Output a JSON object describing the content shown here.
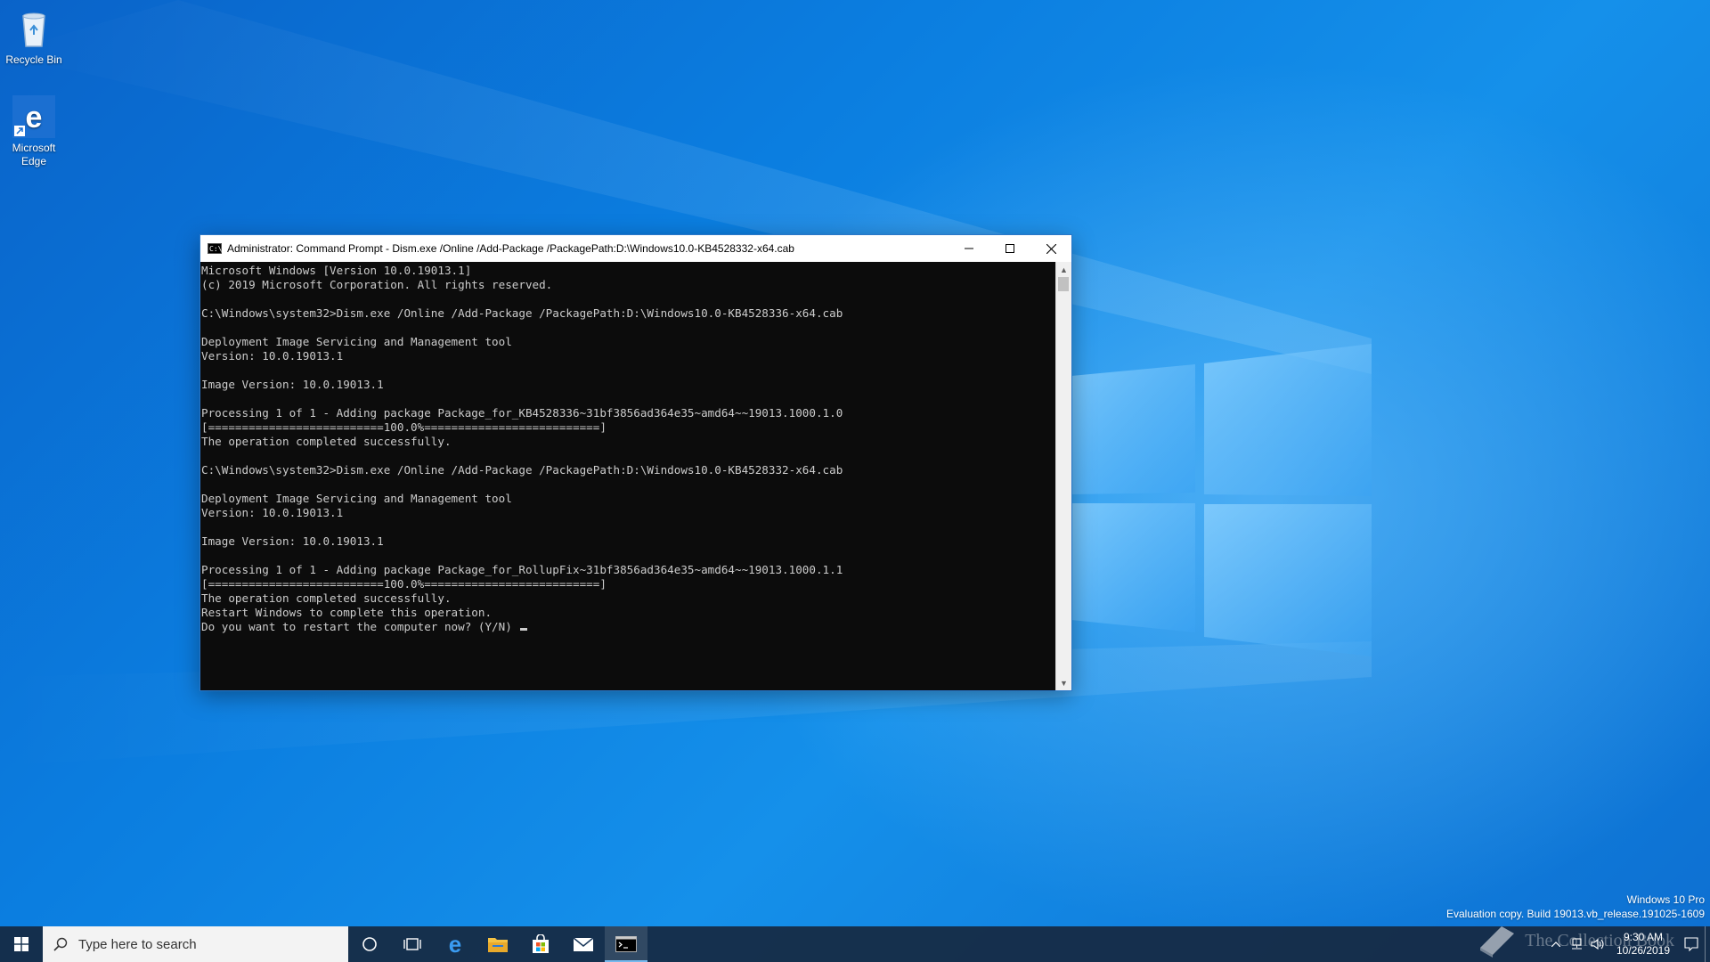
{
  "desktop": {
    "icons": [
      {
        "label": "Recycle Bin",
        "icon": "recycle-bin-icon"
      },
      {
        "label": "Microsoft Edge",
        "icon": "edge-icon"
      }
    ]
  },
  "window": {
    "title": "Administrator: Command Prompt - Dism.exe  /Online /Add-Package /PackagePath:D:\\Windows10.0-KB4528332-x64.cab",
    "controls": {
      "minimize": "minimize-icon",
      "maximize": "maximize-icon",
      "close": "close-icon"
    },
    "console_lines": [
      "Microsoft Windows [Version 10.0.19013.1]",
      "(c) 2019 Microsoft Corporation. All rights reserved.",
      "",
      "C:\\Windows\\system32>Dism.exe /Online /Add-Package /PackagePath:D:\\Windows10.0-KB4528336-x64.cab",
      "",
      "Deployment Image Servicing and Management tool",
      "Version: 10.0.19013.1",
      "",
      "Image Version: 10.0.19013.1",
      "",
      "Processing 1 of 1 - Adding package Package_for_KB4528336~31bf3856ad364e35~amd64~~19013.1000.1.0",
      "[==========================100.0%==========================]",
      "The operation completed successfully.",
      "",
      "C:\\Windows\\system32>Dism.exe /Online /Add-Package /PackagePath:D:\\Windows10.0-KB4528332-x64.cab",
      "",
      "Deployment Image Servicing and Management tool",
      "Version: 10.0.19013.1",
      "",
      "Image Version: 10.0.19013.1",
      "",
      "Processing 1 of 1 - Adding package Package_for_RollupFix~31bf3856ad364e35~amd64~~19013.1000.1.1",
      "[==========================100.0%==========================]",
      "The operation completed successfully.",
      "Restart Windows to complete this operation.",
      "Do you want to restart the computer now? (Y/N) "
    ]
  },
  "taskbar": {
    "search_placeholder": "Type here to search",
    "pinned": [
      "start-icon",
      "cortana-icon",
      "task-view-icon",
      "edge-icon",
      "file-explorer-icon",
      "store-icon",
      "mail-icon",
      "command-prompt-icon"
    ],
    "active": "command-prompt-icon",
    "clock": {
      "time": "9:30 AM",
      "date": "10/26/2019"
    }
  },
  "watermark": {
    "edition": "Windows 10 Pro",
    "build": "Evaluation copy. Build 19013.vb_release.191025-1609"
  },
  "brand_watermark": "The Collection Book",
  "colors": {
    "accent": "#0078d7",
    "console_bg": "#0c0c0c",
    "console_fg": "#cccccc",
    "taskbar": "#162840"
  }
}
